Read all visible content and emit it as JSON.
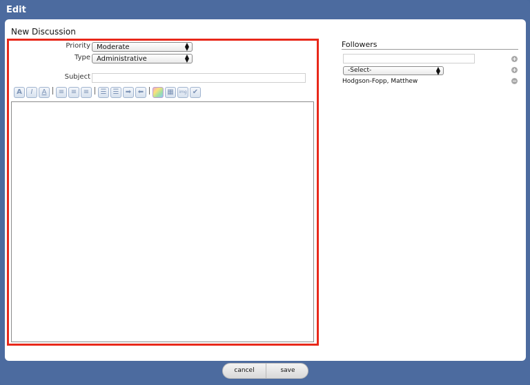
{
  "window": {
    "title": "Edit"
  },
  "form": {
    "heading": "New Discussion",
    "priority": {
      "label": "Priority",
      "value": "Moderate"
    },
    "type": {
      "label": "Type",
      "value": "Administrative"
    },
    "subject": {
      "label": "Subject",
      "value": ""
    }
  },
  "toolbar": {
    "buttons": [
      {
        "icon": "bold-icon",
        "glyph": "A"
      },
      {
        "icon": "italic-icon",
        "glyph": "I"
      },
      {
        "icon": "underline-icon",
        "glyph": "A"
      },
      {
        "icon": "align-left-icon",
        "glyph": "≡"
      },
      {
        "icon": "align-center-icon",
        "glyph": "≡"
      },
      {
        "icon": "align-right-icon",
        "glyph": "≡"
      },
      {
        "icon": "ordered-list-icon",
        "glyph": "☰"
      },
      {
        "icon": "unordered-list-icon",
        "glyph": "☰"
      },
      {
        "icon": "indent-icon",
        "glyph": "➡"
      },
      {
        "icon": "outdent-icon",
        "glyph": "⬅"
      },
      {
        "icon": "color-icon",
        "glyph": ""
      },
      {
        "icon": "table-icon",
        "glyph": "▦"
      },
      {
        "icon": "image-icon",
        "glyph": "img"
      },
      {
        "icon": "spellcheck-icon",
        "glyph": "✔"
      }
    ]
  },
  "followers": {
    "title": "Followers",
    "search_value": "",
    "select_value": "-Select-",
    "items": [
      "Hodgson-Fopp, Matthew"
    ]
  },
  "footer": {
    "cancel_label": "cancel",
    "save_label": "save"
  },
  "colors": {
    "title_bar": "#4c6b9f",
    "highlight": "#e8281a"
  }
}
